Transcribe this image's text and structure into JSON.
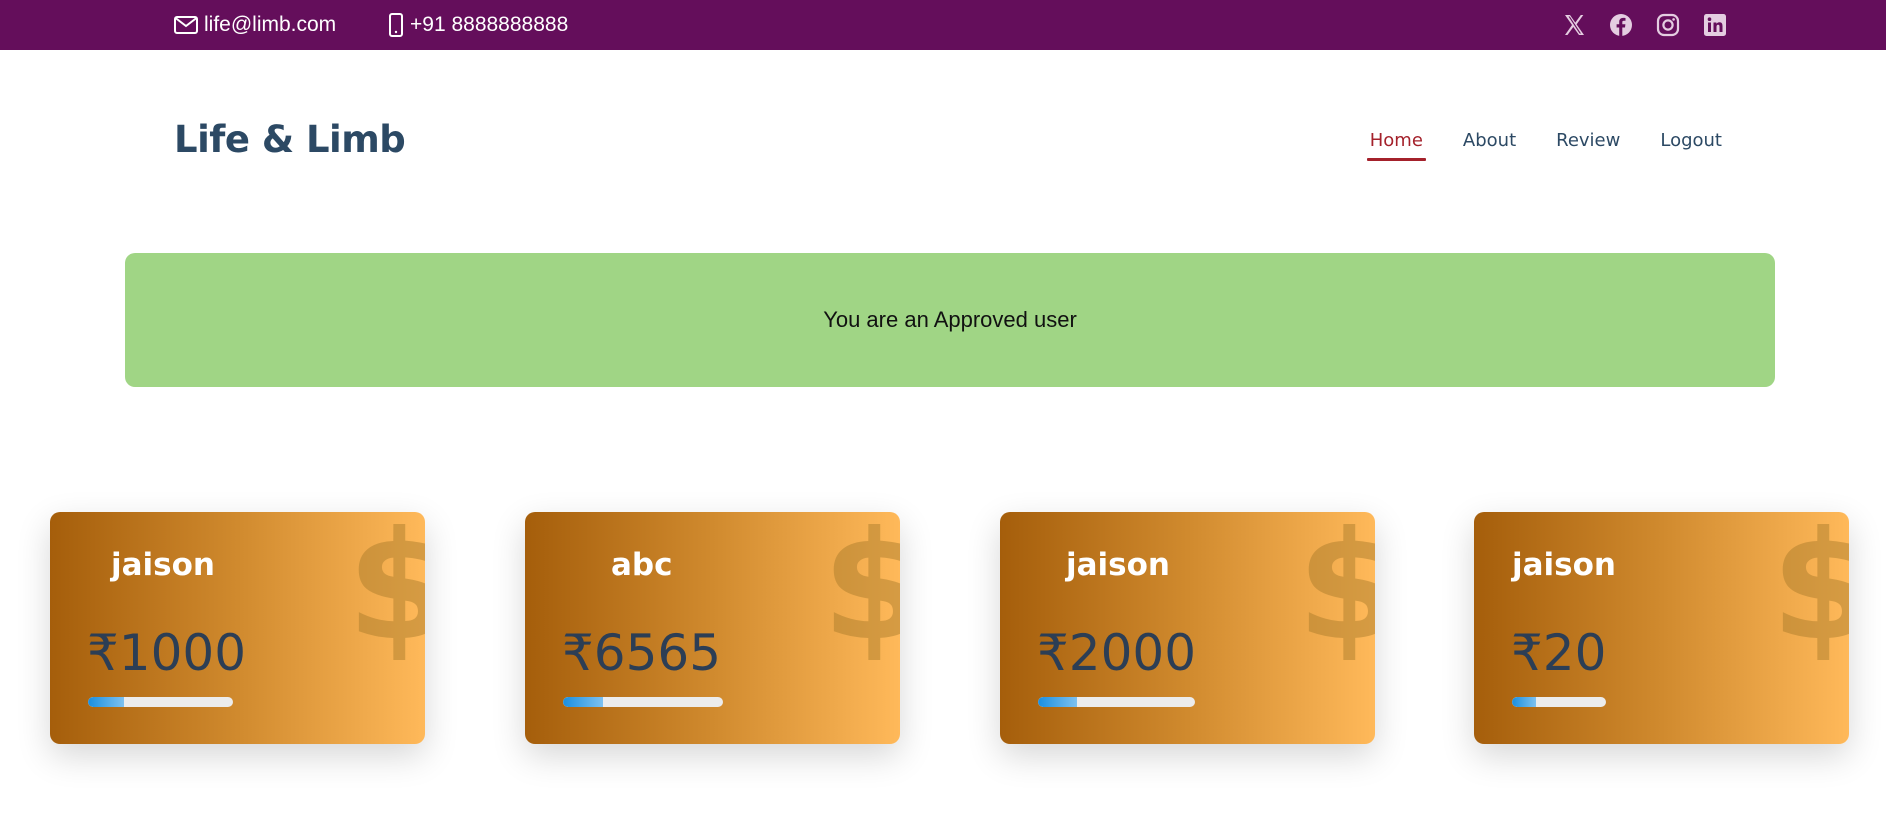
{
  "topbar": {
    "email": "life@limb.com",
    "phone": "+91 8888888888",
    "social": [
      "x-twitter-icon",
      "facebook-icon",
      "instagram-icon",
      "linkedin-icon"
    ]
  },
  "header": {
    "logo": "Life & Limb",
    "nav": [
      "Home",
      "About",
      "Review",
      "Logout"
    ],
    "active": "Home"
  },
  "alert": {
    "message": "You are an Approved user"
  },
  "cards": [
    {
      "name": "jaison",
      "amount": "₹1000",
      "progress": 0.25
    },
    {
      "name": "abc",
      "amount": "₹6565",
      "progress": 0.25
    },
    {
      "name": "jaison",
      "amount": "₹2000",
      "progress": 0.25
    },
    {
      "name": "jaison",
      "amount": "₹20",
      "progress": 0.25
    }
  ],
  "card_icon": "$",
  "colors": {
    "topbar": "#640e5b",
    "brand_text": "#2c4964",
    "nav_active": "#a4212b",
    "alert_bg": "#a0d585",
    "card_gradient_start": "#a55e0b",
    "card_gradient_end": "#ffb95a",
    "progress_fill": "#1a8fe0"
  }
}
